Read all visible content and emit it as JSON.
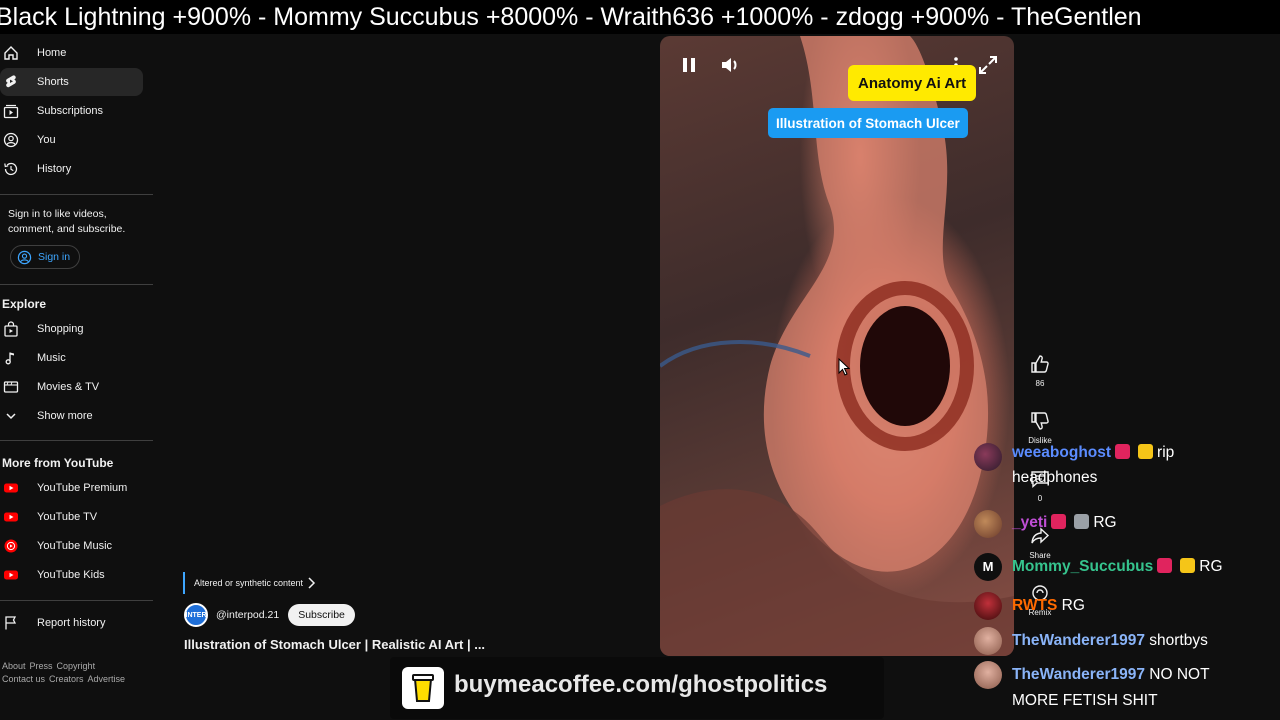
{
  "ticker": {
    "text": "Black Lightning +900%  -  Mommy Succubus +8000% - Wraith636 +1000% - zdogg +900% - TheGentlen"
  },
  "sidebar": {
    "nav": [
      {
        "label": "Home",
        "icon": "home-icon"
      },
      {
        "label": "Shorts",
        "icon": "shorts-icon"
      },
      {
        "label": "Subscriptions",
        "icon": "subscriptions-icon"
      },
      {
        "label": "You",
        "icon": "you-icon"
      },
      {
        "label": "History",
        "icon": "history-icon"
      }
    ],
    "signin_text": "Sign in to like videos, comment, and subscribe.",
    "signin_button": "Sign in",
    "explore_title": "Explore",
    "explore": [
      {
        "label": "Shopping",
        "icon": "shopping-icon"
      },
      {
        "label": "Music",
        "icon": "music-icon"
      },
      {
        "label": "Movies & TV",
        "icon": "movies-icon"
      },
      {
        "label": "Show more",
        "icon": "chevron-down-icon"
      }
    ],
    "more_title": "More from YouTube",
    "more": [
      {
        "label": "YouTube Premium"
      },
      {
        "label": "YouTube TV"
      },
      {
        "label": "YouTube Music"
      },
      {
        "label": "YouTube Kids"
      }
    ],
    "report_history": "Report history",
    "footer_line1": [
      "About",
      "Press",
      "Copyright"
    ],
    "footer_line2": [
      "Contact us",
      "Creators",
      "Advertise"
    ]
  },
  "video": {
    "badge": "Altered or synthetic content",
    "channel": "@interpod.21",
    "channel_avatar_text": "INTER",
    "subscribe": "Subscribe",
    "title": "Illustration of Stomach Ulcer | Realistic AI Art | ...",
    "overlay_title": "Anatomy Ai Art",
    "overlay_subtitle": "Illustration of Stomach Ulcer"
  },
  "actions": {
    "likes": "86",
    "dislike": "Dislike",
    "comments": "0",
    "share": "Share",
    "remix": "Remix"
  },
  "chat": [
    {
      "name": "weeaboghost",
      "color": "#5b8cff",
      "badges": [
        "#e0245e",
        "#f5c518"
      ],
      "text": "rip",
      "text2": "headphones"
    },
    {
      "name": "_yeti",
      "color": "#c04fd6",
      "badges": [
        "#e0245e",
        "#9aa0a6"
      ],
      "text": "RG"
    },
    {
      "name": "Mommy_Succubus",
      "color": "#36c48e",
      "badges": [
        "#e0245e",
        "#f5c518"
      ],
      "text": "RG"
    },
    {
      "name": "RWTS",
      "color": "#ff6a00",
      "badges": [],
      "text": "RG"
    },
    {
      "name": "TheWanderer1997",
      "color": "#8ab4f8",
      "badges": [],
      "text": "shortbys"
    },
    {
      "name": "TheWanderer1997",
      "color": "#8ab4f8",
      "badges": [],
      "text": "NO NOT",
      "text2": "MORE FETISH SHIT"
    }
  ],
  "coffee": {
    "text": "buymeacoffee.com/ghostpolitics"
  },
  "colors": {
    "accent_blue": "#3ea6ff",
    "youtube_red": "#ff0000",
    "tag_yellow": "#ffea00",
    "tag_blue": "#1a9bf2"
  }
}
